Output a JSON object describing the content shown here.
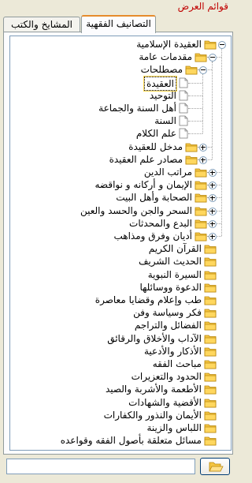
{
  "window": {
    "title": "قوائم العرض"
  },
  "tabs": [
    {
      "label": "المشايخ والكتب",
      "active": false
    },
    {
      "label": "التصانيف الفقهية",
      "active": true
    }
  ],
  "tree": [
    {
      "label": "العقيدة الإسلامية",
      "level": 0,
      "icon": "folder-icon",
      "expander": "minus"
    },
    {
      "label": "مقدمات عامة",
      "level": 1,
      "icon": "folder-icon",
      "expander": "minus"
    },
    {
      "label": "مصطلحات",
      "level": 2,
      "icon": "folder-icon",
      "expander": "minus"
    },
    {
      "label": "العقيدة",
      "level": 3,
      "icon": "document-icon",
      "selected": true
    },
    {
      "label": "التوحيد",
      "level": 3,
      "icon": "document-icon"
    },
    {
      "label": "أهل السنة والجماعة",
      "level": 3,
      "icon": "document-icon"
    },
    {
      "label": "السنة",
      "level": 3,
      "icon": "document-icon"
    },
    {
      "label": "علم الكلام",
      "level": 3,
      "icon": "document-icon"
    },
    {
      "label": "مدخل للعقيدة",
      "level": 2,
      "icon": "folder-icon",
      "expander": "plus"
    },
    {
      "label": "مصادر علم العقيدة",
      "level": 2,
      "icon": "folder-icon",
      "expander": "plus"
    },
    {
      "label": "مراتب الدين",
      "level": 1,
      "icon": "folder-icon",
      "expander": "plus"
    },
    {
      "label": "الإيمان و أركانه و نواقضه",
      "level": 1,
      "icon": "folder-icon",
      "expander": "plus"
    },
    {
      "label": "الصحابة وأهل البيت",
      "level": 1,
      "icon": "folder-icon",
      "expander": "plus"
    },
    {
      "label": "السحر والجن والحسد والعين",
      "level": 1,
      "icon": "folder-icon",
      "expander": "plus"
    },
    {
      "label": "البدع والمحدثات",
      "level": 1,
      "icon": "folder-icon",
      "expander": "plus"
    },
    {
      "label": "أديان وفرق ومذاهب",
      "level": 1,
      "icon": "folder-icon",
      "expander": "plus"
    },
    {
      "label": "القرآن الكريم",
      "level": 0,
      "icon": "folder-icon"
    },
    {
      "label": "الحديث الشريف",
      "level": 0,
      "icon": "folder-icon"
    },
    {
      "label": "السيرة النبوية",
      "level": 0,
      "icon": "folder-icon"
    },
    {
      "label": "الدعوة ووسائلها",
      "level": 0,
      "icon": "folder-icon"
    },
    {
      "label": "طب وإعلام وقضايا معاصرة",
      "level": 0,
      "icon": "folder-icon"
    },
    {
      "label": "فكر وسياسة وفن",
      "level": 0,
      "icon": "folder-icon"
    },
    {
      "label": "الفضائل والتراجم",
      "level": 0,
      "icon": "folder-icon"
    },
    {
      "label": "الآداب والأخلاق والرقائق",
      "level": 0,
      "icon": "folder-icon"
    },
    {
      "label": "الأذكار والأدعية",
      "level": 0,
      "icon": "folder-icon"
    },
    {
      "label": "مباحث الفقه",
      "level": 0,
      "icon": "folder-icon"
    },
    {
      "label": "الحدود والتعزيرات",
      "level": 0,
      "icon": "folder-icon"
    },
    {
      "label": "الأطعمة والأشربة والصيد",
      "level": 0,
      "icon": "folder-icon"
    },
    {
      "label": "الأقضية والشهادات",
      "level": 0,
      "icon": "folder-icon"
    },
    {
      "label": "الأيمان والنذور والكفارات",
      "level": 0,
      "icon": "folder-icon"
    },
    {
      "label": "اللباس والزينة",
      "level": 0,
      "icon": "folder-icon"
    },
    {
      "label": "مسائل متعلقة بأصول الفقه وقواعده",
      "level": 0,
      "icon": "folder-icon"
    }
  ],
  "search": {
    "value": "",
    "placeholder": ""
  },
  "open_button": {
    "icon": "folder-open-icon"
  },
  "colors": {
    "accent": "#e68b2c",
    "title": "#c00000",
    "folder": "#f5c542",
    "selection": "#ffd84d"
  }
}
